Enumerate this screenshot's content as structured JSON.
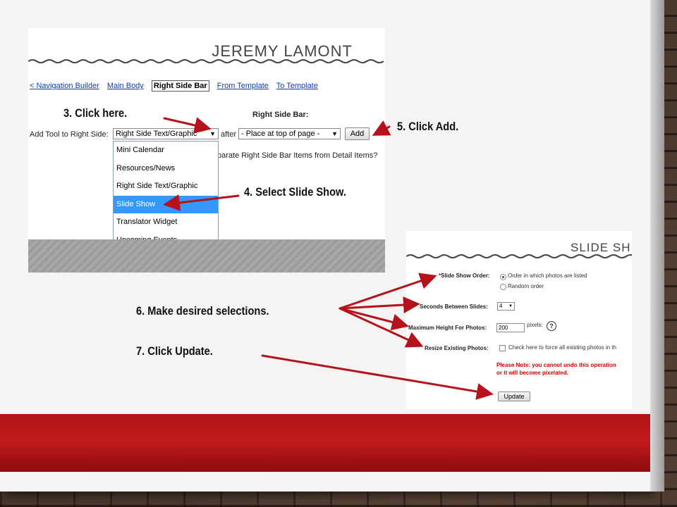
{
  "panel1": {
    "title": "JEREMY LAMONT",
    "tabs": [
      "< Navigation Builder",
      "Main Body",
      "Right Side Bar",
      "From Template",
      "To Template"
    ],
    "active_tab_index": 2,
    "section_title": "Right Side Bar:",
    "add_tool_label": "Add Tool to Right Side:",
    "tool_select_value": "Right Side Text/Graphic",
    "after_label": "after",
    "position_select_value": "- Place at top of page -",
    "add_button": "Add",
    "separate_label": "parate Right Side Bar Items from Detail Items?",
    "dropdown_options": [
      "Mini Calendar",
      "Resources/News",
      "Right Side Text/Graphic",
      "Slide Show",
      "Translator Widget",
      "Upcoming Events"
    ],
    "dropdown_highlight_index": 3
  },
  "panel2": {
    "title": "SLIDE SH",
    "order_label_req": "*",
    "order_label": "Slide Show Order:",
    "order_options": [
      "Order in which photos are listed",
      "Random order"
    ],
    "seconds_label": "Seconds Between Slides:",
    "seconds_value": "4",
    "height_label": "Maximum Height For Photos:",
    "height_value": "200",
    "pixels_label": "pixels:",
    "help_glyph": "?",
    "resize_label": "Resize Existing Photos:",
    "resize_text": "Check here to force all existing photos in th",
    "note_line1": "Please Note: you cannot undo this operation",
    "note_line2": "or it will become pixelated.",
    "update_button": "Update"
  },
  "steps": {
    "s3": "3.  Click here.",
    "s4": "4.  Select Slide Show.",
    "s5": "5.  Click Add.",
    "s6": "6.    Make desired selections.",
    "s7": "7.    Click Update."
  },
  "colors": {
    "arrow": "#b5121b",
    "red_band": "#c2191c",
    "highlight": "#3399ff",
    "link": "#0645ad"
  }
}
